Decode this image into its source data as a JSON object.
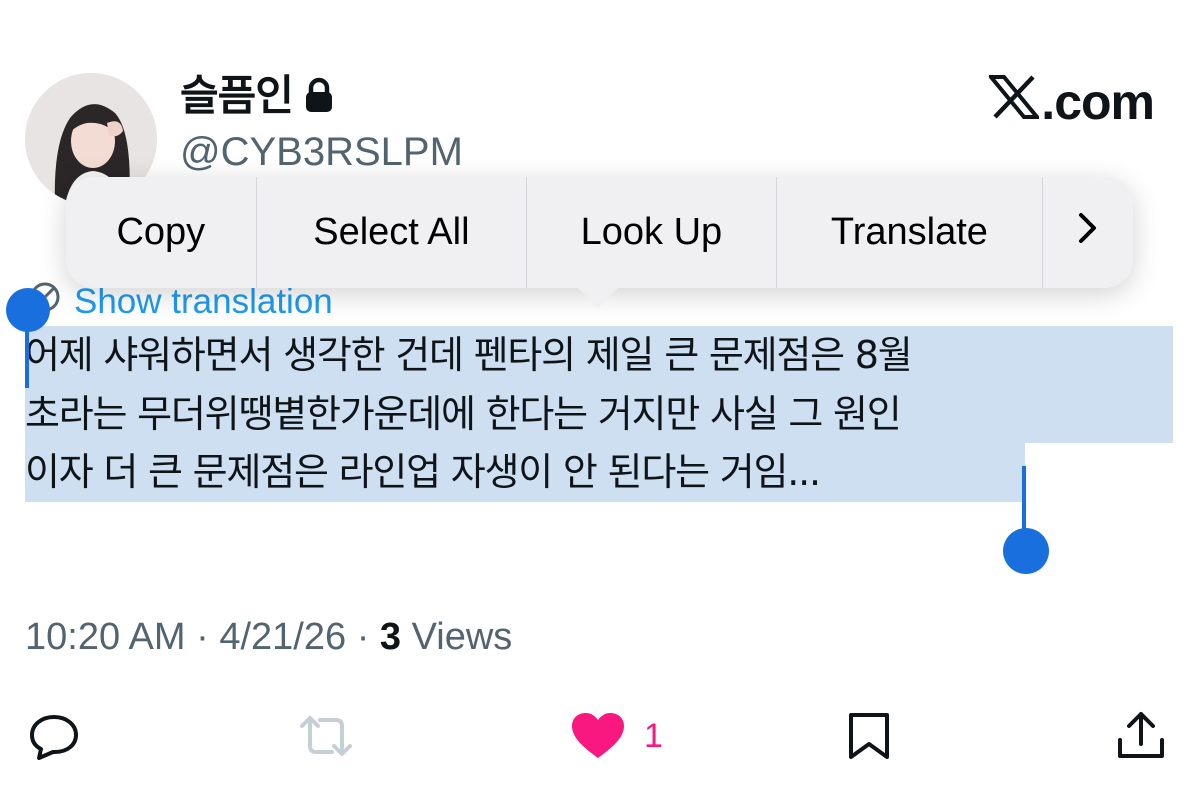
{
  "header": {
    "display_name": "슬픔인",
    "handle": "@CYB3RSLPM",
    "brand": ".com",
    "brand_icon": "x-logo-icon",
    "locked": true
  },
  "context_menu": {
    "items": [
      "Copy",
      "Select All",
      "Look Up",
      "Translate"
    ],
    "more_icon": "chevron-right-icon"
  },
  "show_translation": "Show translation",
  "tweet": {
    "lines": [
      "어제 샤워하면서 생각한 건데 펜타의 제일 큰 문제점은 8월",
      "초라는 무더위땡볕한가운데에 한다는 거지만 사실 그 원인",
      "이자 더 큰 문제점은 라인업 자생이 안 된다는 거임..."
    ],
    "selection_color": "#cddff0"
  },
  "meta": {
    "time": "10:20 AM",
    "date": "4/21/26",
    "views_count": "3",
    "views_label": "Views",
    "separator": "·"
  },
  "actions": {
    "reply_icon": "reply-icon",
    "repost_icon": "repost-icon",
    "like_icon": "heart-icon",
    "like_count": "1",
    "like_color": "#f91880",
    "bookmark_icon": "bookmark-icon",
    "share_icon": "share-icon"
  }
}
